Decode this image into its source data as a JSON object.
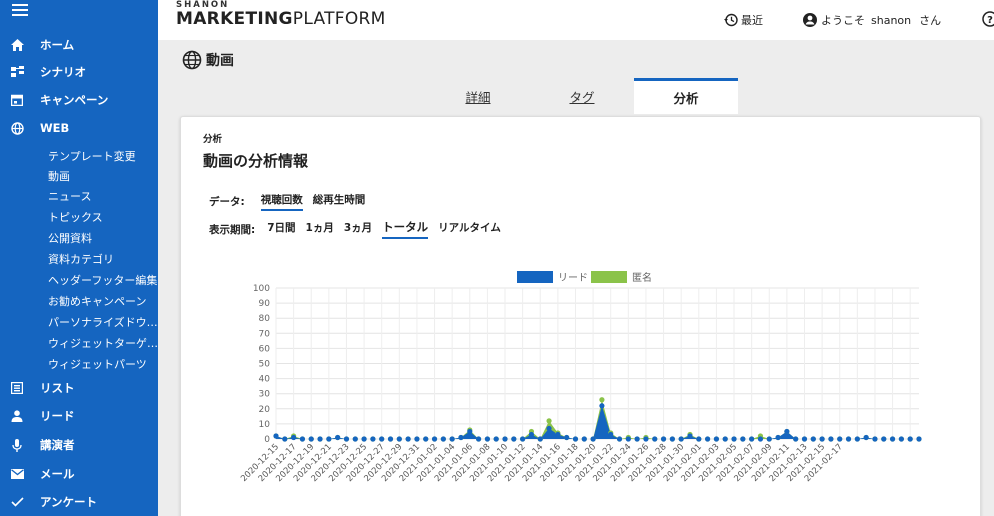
{
  "sidebar": {
    "items": [
      {
        "label": "ホーム",
        "icon": "home-icon"
      },
      {
        "label": "シナリオ",
        "icon": "scenario-icon"
      },
      {
        "label": "キャンペーン",
        "icon": "calendar-icon"
      },
      {
        "label": "WEB",
        "icon": "globe-icon"
      },
      {
        "label": "リスト",
        "icon": "list-icon"
      },
      {
        "label": "リード",
        "icon": "person-icon"
      },
      {
        "label": "講演者",
        "icon": "microphone-icon"
      },
      {
        "label": "メール",
        "icon": "mail-icon"
      },
      {
        "label": "アンケート",
        "icon": "check-icon"
      }
    ],
    "web_sub_items": [
      "テンプレート変更",
      "動画",
      "ニュース",
      "トピックス",
      "公開資料",
      "資料カテゴリ",
      "ヘッダーフッター編集",
      "お勧めキャンペーン",
      "パーソナライズドウ…",
      "ウィジェットターゲ…",
      "ウィジェットパーツ"
    ]
  },
  "header": {
    "brand_small": "SHANON",
    "brand_marketing": "MARKETING",
    "brand_platform": "PLATFORM",
    "recent_label": "最近",
    "welcome_prefix": "ようこそ",
    "username": "shanon",
    "welcome_suffix": "さん"
  },
  "page": {
    "title": "動画",
    "tabs": [
      {
        "label": "詳細",
        "active": false
      },
      {
        "label": "タグ",
        "active": false
      },
      {
        "label": "分析",
        "active": true
      }
    ]
  },
  "card": {
    "label": "分析",
    "title": "動画の分析情報",
    "data_label": "データ:",
    "data_options": [
      {
        "label": "視聴回数",
        "selected": true
      },
      {
        "label": "総再生時間",
        "selected": false
      }
    ],
    "period_label": "表示期間:",
    "period_options": [
      {
        "label": "7日間",
        "selected": false
      },
      {
        "label": "1ヵ月",
        "selected": false
      },
      {
        "label": "3ヵ月",
        "selected": false
      },
      {
        "label": "トータル",
        "selected": true
      },
      {
        "label": "リアルタイム",
        "selected": false
      }
    ]
  },
  "colors": {
    "sidebar": "#1565c0",
    "lead": "#1565c0",
    "anonymous": "#8bc34a"
  },
  "chart_data": {
    "type": "area",
    "stacked": true,
    "legend_position": "top-center",
    "grid": true,
    "ylim": [
      0,
      100
    ],
    "yticks": [
      0,
      10,
      20,
      30,
      40,
      50,
      60,
      70,
      80,
      90,
      100
    ],
    "x_tick_labels": [
      "2020-12-15",
      "2020-12-17",
      "2020-12-19",
      "2020-12-21",
      "2020-12-23",
      "2020-12-25",
      "2020-12-27",
      "2020-12-29",
      "2020-12-31",
      "2021-01-02",
      "2021-01-04",
      "2021-01-06",
      "2021-01-08",
      "2021-01-10",
      "2021-01-12",
      "2021-01-14",
      "2021-01-16",
      "2021-01-18",
      "2021-01-20",
      "2021-01-22",
      "2021-01-24",
      "2021-01-26",
      "2021-01-28",
      "2021-01-30",
      "2021-02-01",
      "2021-02-03",
      "2021-02-05",
      "2021-02-07",
      "2021-02-09",
      "2021-02-11",
      "2021-02-13",
      "2021-02-15",
      "2021-02-17"
    ],
    "series": [
      {
        "name": "リード",
        "values": [
          2,
          0,
          1,
          0,
          0,
          0,
          0,
          1,
          0,
          0,
          0,
          0,
          0,
          0,
          0,
          0,
          0,
          0,
          0,
          0,
          0,
          1,
          5,
          0,
          0,
          0,
          0,
          0,
          0,
          3,
          0,
          7,
          3,
          1,
          0,
          0,
          0,
          22,
          3,
          0,
          0,
          0,
          0,
          0,
          0,
          0,
          0,
          2,
          0,
          0,
          0,
          0,
          0,
          0,
          0,
          0,
          0,
          1,
          5,
          0,
          0,
          0,
          0,
          0,
          0,
          0,
          0,
          1,
          0,
          0,
          0,
          0,
          0,
          0
        ]
      },
      {
        "name": "匿名",
        "values": [
          0,
          0,
          1,
          0,
          0,
          0,
          0,
          0,
          0,
          0,
          0,
          0,
          0,
          0,
          0,
          0,
          0,
          0,
          0,
          0,
          0,
          0,
          1,
          0,
          0,
          0,
          0,
          0,
          0,
          2,
          0,
          5,
          1,
          0,
          0,
          0,
          0,
          4,
          1,
          0,
          1,
          0,
          1,
          0,
          0,
          0,
          0,
          1,
          0,
          0,
          0,
          0,
          0,
          0,
          0,
          2,
          0,
          0,
          0,
          0,
          0,
          0,
          0,
          0,
          0,
          0,
          0,
          0,
          0,
          0,
          0,
          0,
          0,
          0
        ]
      }
    ]
  }
}
